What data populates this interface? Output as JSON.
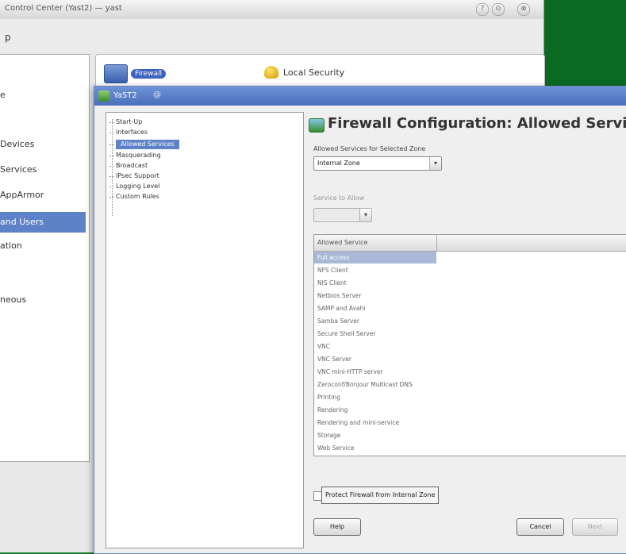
{
  "control_center": {
    "title": "Control Center (Yast2) — yast",
    "menu_label": "p",
    "window_buttons": [
      "?",
      "⊙",
      "⊗"
    ],
    "categories": [
      {
        "label": "",
        "active": false
      },
      {
        "label": "e",
        "active": false
      },
      {
        "label": "Devices",
        "active": false
      },
      {
        "label": "Services",
        "active": false
      },
      {
        "label": "AppArmor",
        "active": false
      },
      {
        "label": "and Users",
        "active": true
      },
      {
        "label": "ation",
        "active": false
      },
      {
        "label": "neous",
        "active": false
      }
    ],
    "modules": {
      "firewall_label": "Firewall",
      "security_label": "Local Security"
    }
  },
  "dialog": {
    "title": "YaST2",
    "title_extra": "@",
    "heading": "Firewall Configuration: Allowed Services",
    "tree": [
      {
        "label": "Start-Up",
        "selected": false
      },
      {
        "label": "Interfaces",
        "selected": false
      },
      {
        "label": "Allowed Services",
        "selected": true
      },
      {
        "label": "Masquerading",
        "selected": false
      },
      {
        "label": "Broadcast",
        "selected": false
      },
      {
        "label": "IPsec Support",
        "selected": false
      },
      {
        "label": "Logging Level",
        "selected": false
      },
      {
        "label": "Custom Rules",
        "selected": false
      }
    ],
    "zone_label": "Allowed Services for Selected Zone",
    "zone_value": "Internal Zone",
    "service_to_allow_label": "Service to Allow",
    "service_to_allow_value": "",
    "table_header": "Allowed Service",
    "services": [
      {
        "name": "Full access",
        "selected": true
      },
      {
        "name": "NFS Client",
        "selected": false
      },
      {
        "name": "NIS Client",
        "selected": false
      },
      {
        "name": "Netbios Server",
        "selected": false
      },
      {
        "name": "SAMP and Avahi",
        "selected": false
      },
      {
        "name": "Samba Server",
        "selected": false
      },
      {
        "name": "Secure Shell Server",
        "selected": false
      },
      {
        "name": "VNC",
        "selected": false
      },
      {
        "name": "VNC Server",
        "selected": false
      },
      {
        "name": "VNC mini-HTTP server",
        "selected": false
      },
      {
        "name": "Zeroconf/Bonjour Multicast DNS",
        "selected": false
      },
      {
        "name": "Printing",
        "selected": false
      },
      {
        "name": "Rendering",
        "selected": false
      },
      {
        "name": "Rendering and mini-service",
        "selected": false
      },
      {
        "name": "Storage",
        "selected": false
      },
      {
        "name": "Web Service",
        "selected": false
      }
    ],
    "protect_label": "Protect Firewall from Internal Zone",
    "help_button": "Help",
    "cancel_button": "Cancel",
    "next_button": "Next"
  },
  "colors": {
    "selection": "#5e82c8",
    "dialog_titlebar": "#4a6fba",
    "desktop": "#178a38"
  }
}
